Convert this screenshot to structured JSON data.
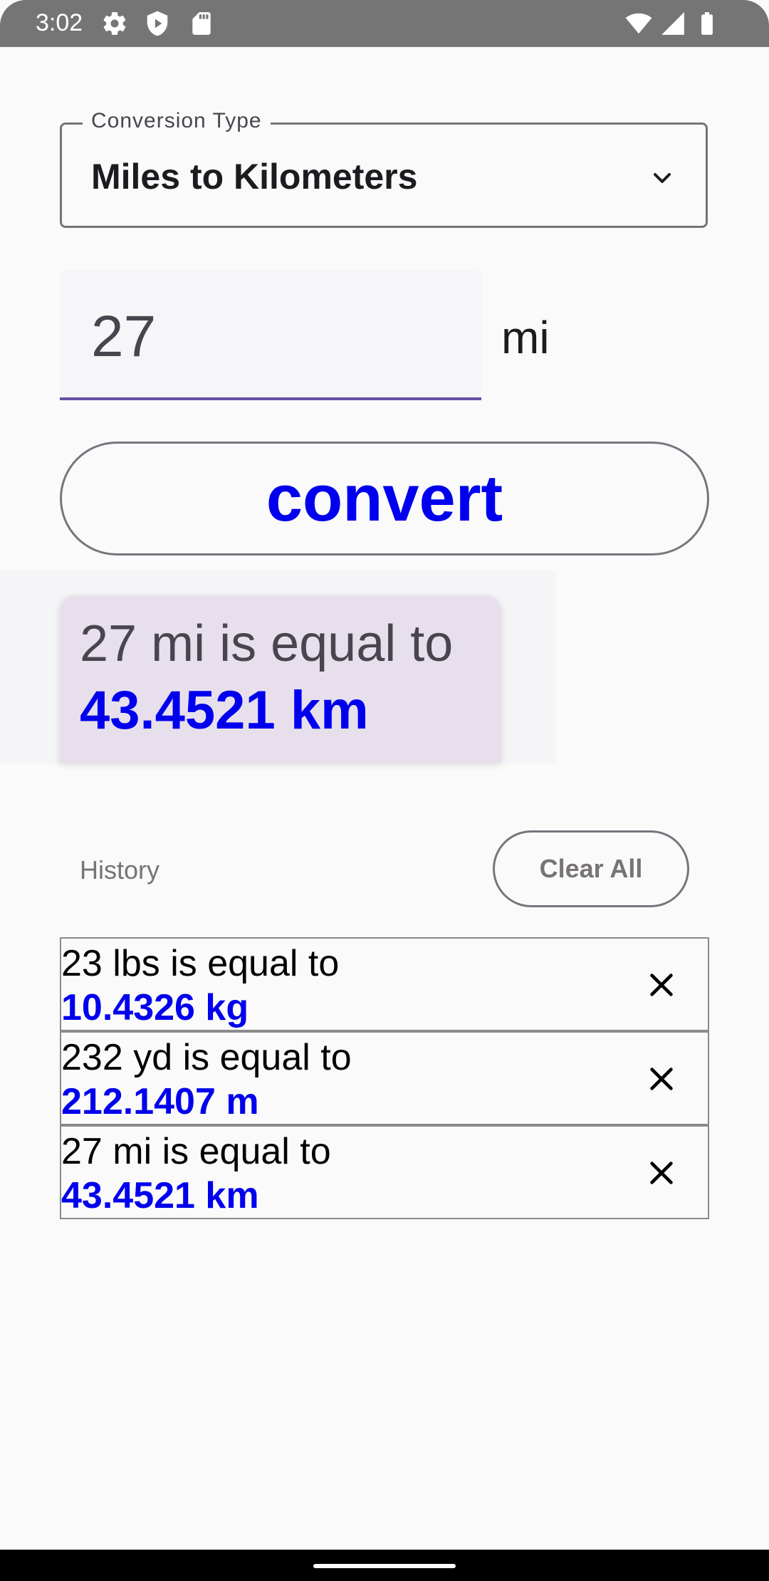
{
  "status_bar": {
    "time": "3:02",
    "icons": [
      "settings-gear-icon",
      "shield-play-icon",
      "sd-card-icon",
      "wifi-icon",
      "cell-signal-icon",
      "battery-icon"
    ]
  },
  "conversion_type": {
    "label": "Conversion Type",
    "selected": "Miles to Kilometers"
  },
  "input": {
    "value": "27",
    "unit": "mi"
  },
  "convert_button": {
    "label": "convert",
    "color": "#0000ee"
  },
  "result": {
    "line1": "27 mi is equal to",
    "line2": "43.4521 km"
  },
  "history": {
    "title": "History",
    "clear_label": "Clear All",
    "items": [
      {
        "line1": "23 lbs is equal to",
        "line2": "10.4326 kg"
      },
      {
        "line1": "232 yd is equal to",
        "line2": "212.1407 m"
      },
      {
        "line1": "27 mi is equal to",
        "line2": "43.4521 km"
      }
    ]
  },
  "colors": {
    "accent": "#6750a4",
    "result_blue": "#0000ee",
    "card_bg": "#e7e0ec"
  }
}
